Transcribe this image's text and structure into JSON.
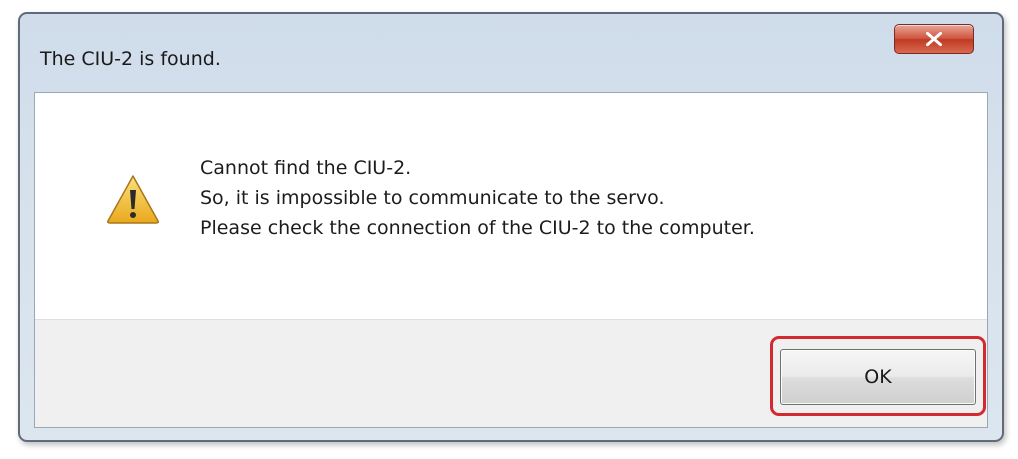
{
  "dialog": {
    "title": "The CIU-2 is found.",
    "close_icon": "close-x-icon",
    "warning_icon": "warning-triangle-icon",
    "messages": [
      "Cannot find the CIU-2.",
      "So, it is impossible to communicate to the servo.",
      "Please check the connection of the CIU-2 to the computer."
    ],
    "ok_label": "OK",
    "highlight_color": "#d32a30",
    "close_button_color": "#c8432c",
    "warning_color": "#f2c23a"
  }
}
